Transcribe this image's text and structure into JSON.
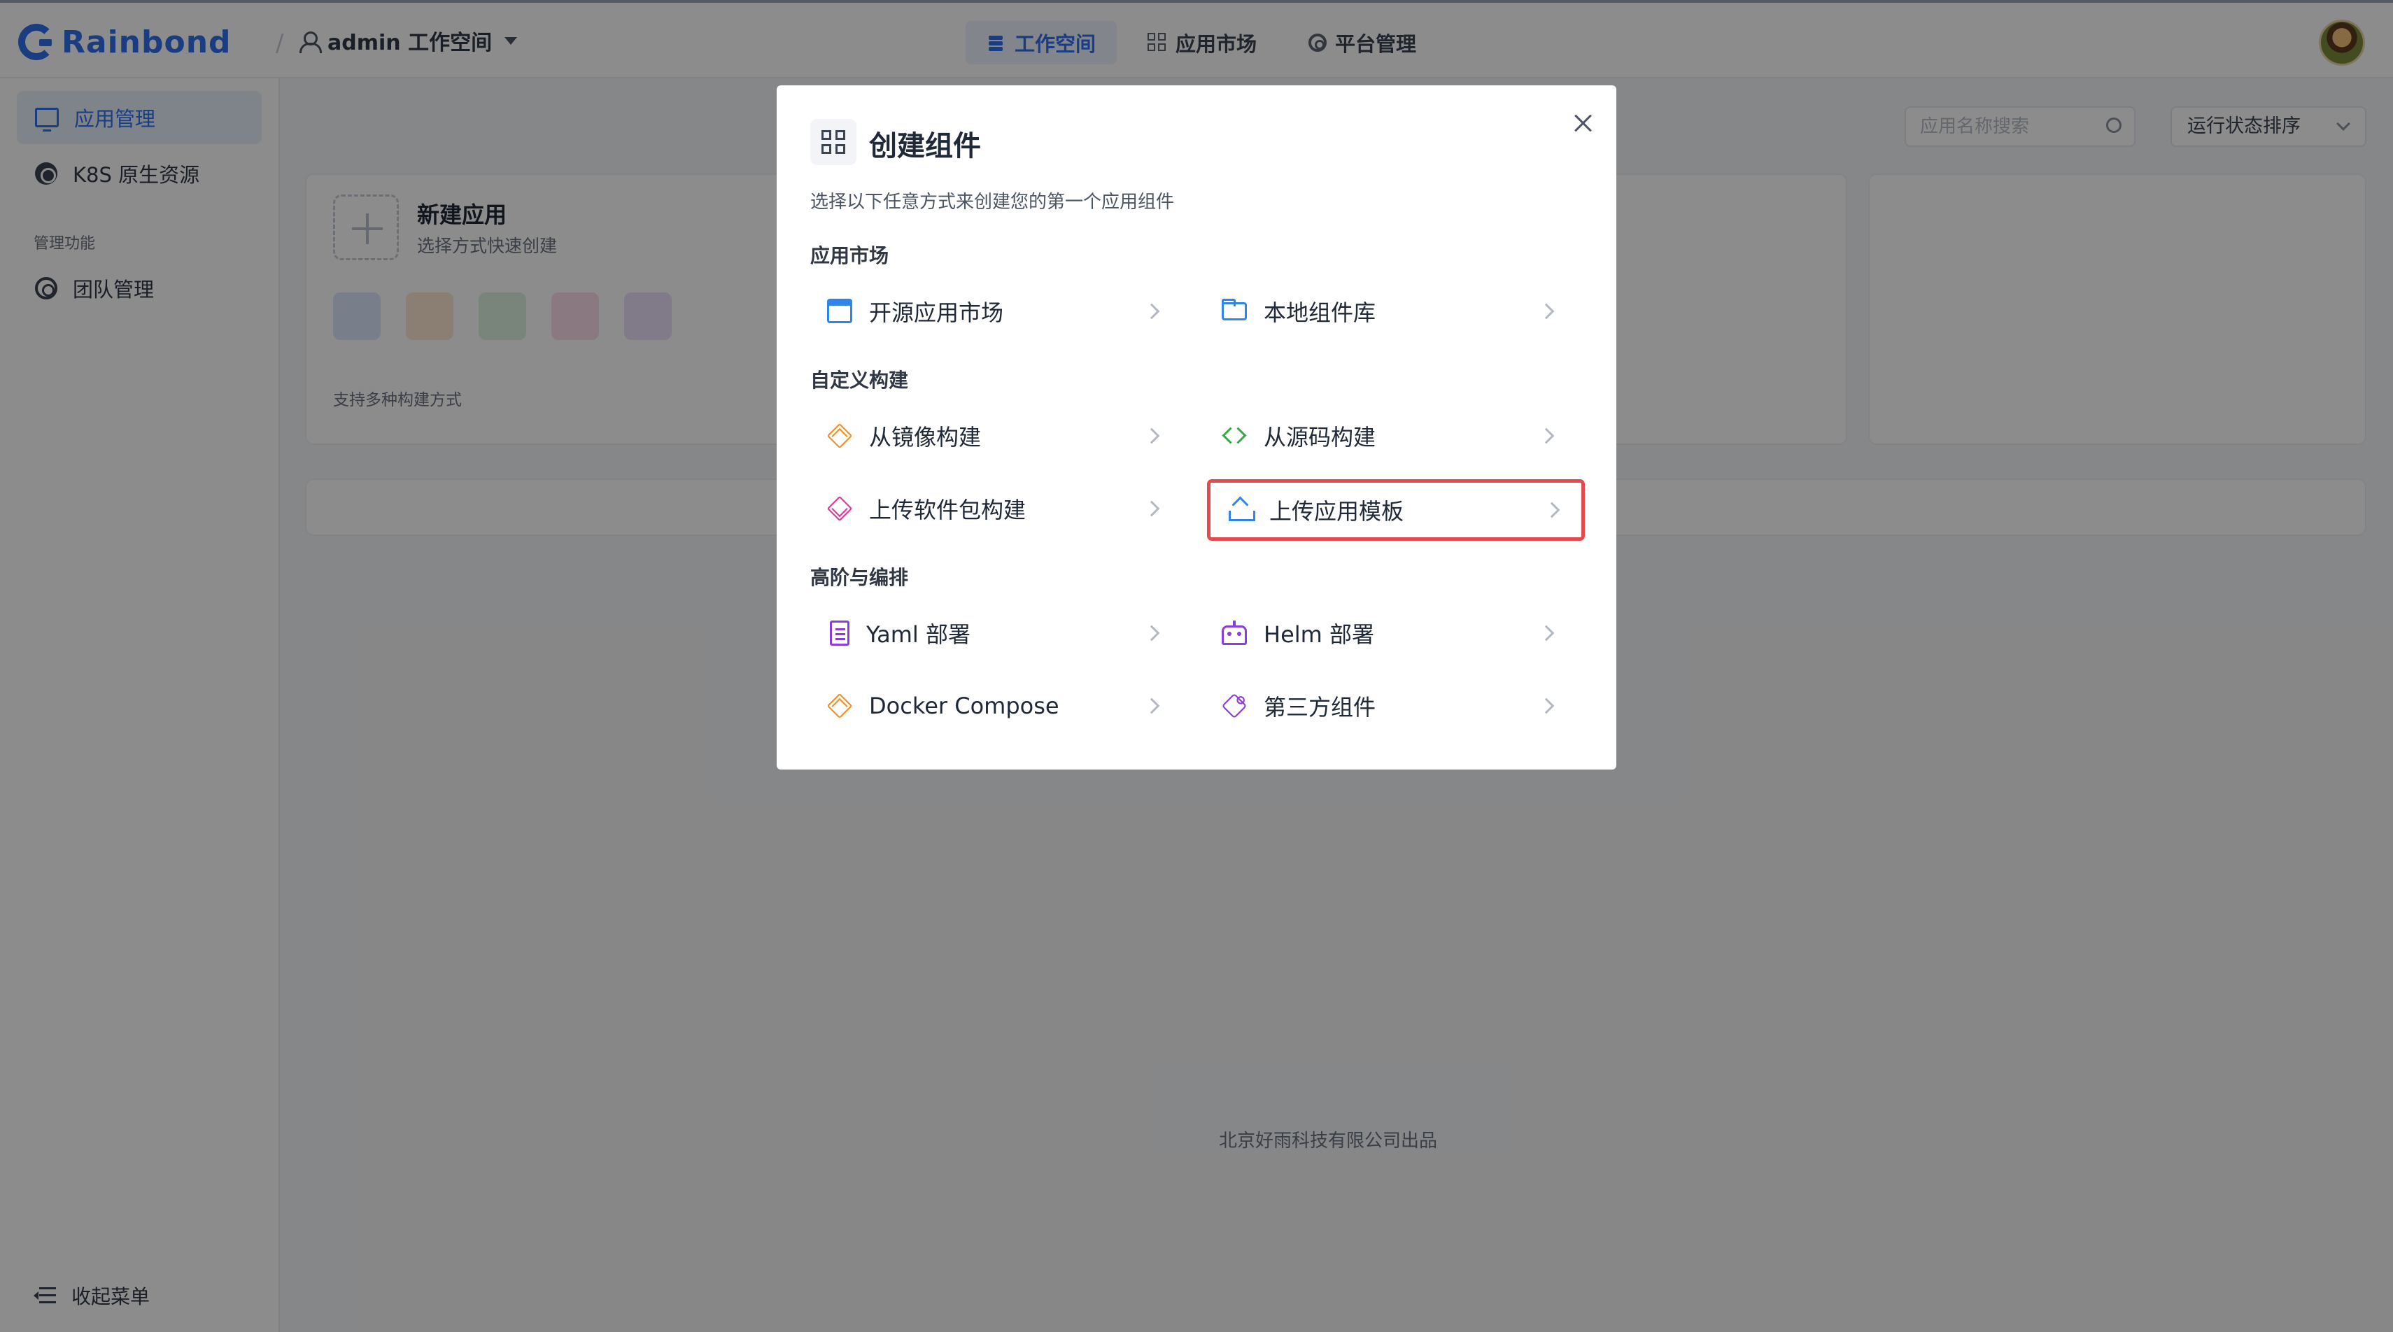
{
  "header": {
    "brand": "Rainbond",
    "workspace_label": "admin 工作空间",
    "nav": [
      {
        "label": "工作空间",
        "active": true
      },
      {
        "label": "应用市场",
        "active": false
      },
      {
        "label": "平台管理",
        "active": false
      }
    ]
  },
  "sidebar": {
    "items": [
      {
        "label": "应用管理",
        "active": true
      },
      {
        "label": "K8S 原生资源",
        "active": false
      }
    ],
    "group_label": "管理功能",
    "group_items": [
      {
        "label": "团队管理"
      }
    ],
    "collapse_label": "收起菜单"
  },
  "toolbar": {
    "search_placeholder": "应用名称搜索",
    "sort_label": "运行状态排序"
  },
  "new_app_card": {
    "title": "新建应用",
    "subtitle": "选择方式快速创建",
    "footer": "支持多种构建方式"
  },
  "footer": {
    "text": "北京好雨科技有限公司出品"
  },
  "modal": {
    "title": "创建组件",
    "description": "选择以下任意方式来创建您的第一个应用组件",
    "sections": [
      {
        "label": "应用市场",
        "options": [
          {
            "label": "开源应用市场"
          },
          {
            "label": "本地组件库"
          }
        ]
      },
      {
        "label": "自定义构建",
        "options": [
          {
            "label": "从镜像构建"
          },
          {
            "label": "从源码构建"
          },
          {
            "label": "上传软件包构建"
          },
          {
            "label": "上传应用模板",
            "highlighted": true
          }
        ]
      },
      {
        "label": "高阶与编排",
        "options": [
          {
            "label": "Yaml 部署"
          },
          {
            "label": "Helm 部署"
          },
          {
            "label": "Docker Compose"
          },
          {
            "label": "第三方组件"
          }
        ]
      }
    ]
  },
  "colors": {
    "accent": "#2f6fea",
    "highlight": "#e5484d"
  }
}
